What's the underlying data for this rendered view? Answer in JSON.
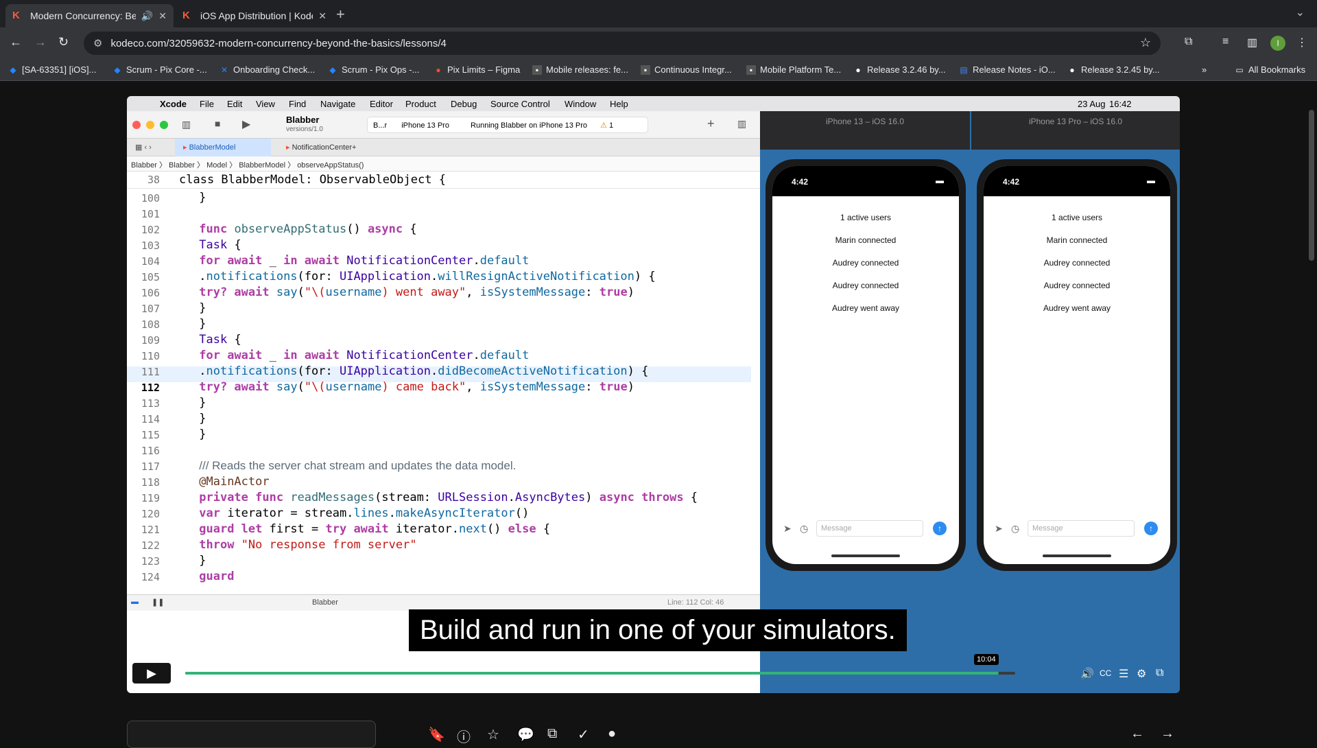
{
  "browser": {
    "tabs": [
      {
        "title": "Modern Concurrency: Be",
        "active": true
      },
      {
        "title": "iOS App Distribution | Kodeco",
        "active": false
      }
    ],
    "url": "kodeco.com/32059632-modern-concurrency-beyond-the-basics/lessons/4",
    "profile_initial": "I",
    "bookmarks": [
      "[SA-63351] [iOS]...",
      "Scrum - Pix Core -...",
      "Onboarding Check...",
      "Scrum - Pix Ops -...",
      "Pix Limits – Figma",
      "Mobile releases: fe...",
      "Continuous Integr...",
      "Mobile Platform Te...",
      "Release 3.2.46 by...",
      "Release Notes - iO...",
      "Release 3.2.45 by..."
    ],
    "all_bookmarks": "All Bookmarks"
  },
  "mac_menu": {
    "items": [
      "Xcode",
      "File",
      "Edit",
      "View",
      "Find",
      "Navigate",
      "Editor",
      "Product",
      "Debug",
      "Source Control",
      "Window",
      "Help"
    ],
    "date": "23 Aug",
    "time": "16:42"
  },
  "xcode": {
    "scheme": "Blabber",
    "scheme_sub": "versions/1.0",
    "target": "B...r",
    "device": "iPhone 13 Pro",
    "status": "Running Blabber on iPhone 13 Pro",
    "warnings": "1",
    "tabs": [
      "BlabberModel",
      "NotificationCenter+"
    ],
    "breadcrumb": [
      "Blabber",
      "Blabber",
      "Model",
      "BlabberModel",
      "observeAppStatus()"
    ],
    "sticky_ln": "38",
    "sticky_code": "class BlabberModel: ObservableObject {",
    "debug_target": "Blabber",
    "cursor": "Line: 112  Col: 46",
    "lines": [
      "100",
      "101",
      "102",
      "103",
      "104",
      "105",
      "106",
      "107",
      "108",
      "109",
      "110",
      "111",
      "112",
      "113",
      "114",
      "115",
      "116",
      "117",
      "118",
      "119",
      "120",
      "121",
      "122",
      "123",
      "124"
    ],
    "current_line": "112"
  },
  "simulators": [
    {
      "title": "iPhone 13 – iOS 16.0",
      "time": "4:42",
      "messages": [
        "1 active users",
        "Marin connected",
        "Audrey connected",
        "Audrey connected",
        "Audrey went away"
      ],
      "placeholder": "Message"
    },
    {
      "title": "iPhone 13 Pro – iOS 16.0",
      "time": "4:42",
      "messages": [
        "1 active users",
        "Marin connected",
        "Audrey connected",
        "Audrey connected",
        "Audrey went away"
      ],
      "placeholder": "Message"
    }
  ],
  "video": {
    "subtitle": "Build and run in one of your simulators.",
    "time_label": "10:04",
    "progress": 0.98
  },
  "colors": {
    "accent": "#34b27a",
    "kodeco": "#ff5a36"
  }
}
